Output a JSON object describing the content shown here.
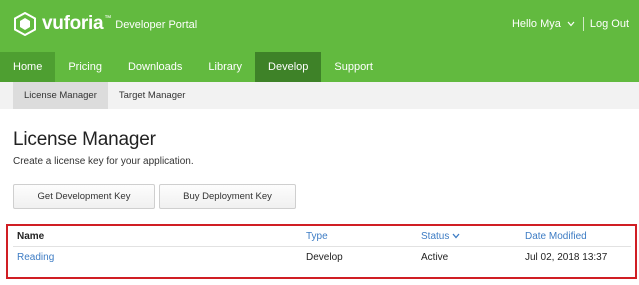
{
  "header": {
    "brand": "vuforia",
    "brand_tm": "™",
    "portal_label": "Developer Portal",
    "user_greeting": "Hello Mya",
    "logout_label": "Log Out"
  },
  "nav": {
    "items": [
      {
        "label": "Home"
      },
      {
        "label": "Pricing"
      },
      {
        "label": "Downloads"
      },
      {
        "label": "Library"
      },
      {
        "label": "Develop"
      },
      {
        "label": "Support"
      }
    ],
    "active": "Develop"
  },
  "subnav": {
    "items": [
      {
        "label": "License Manager"
      },
      {
        "label": "Target Manager"
      }
    ],
    "active": "License Manager"
  },
  "main": {
    "title": "License Manager",
    "description": "Create a license key for your application.",
    "get_dev_key_label": "Get Development Key",
    "buy_deploy_key_label": "Buy Deployment Key"
  },
  "table": {
    "columns": [
      "Name",
      "Type",
      "Status",
      "Date Modified"
    ],
    "rows": [
      {
        "name": "Reading",
        "type": "Develop",
        "status": "Active",
        "date_modified": "Jul 02, 2018 13:37"
      }
    ]
  },
  "colors": {
    "header_green": "#62ba3f",
    "nav_active": "#3e8228",
    "link_blue": "#3d7cc4",
    "highlight_red": "#d01e24"
  }
}
